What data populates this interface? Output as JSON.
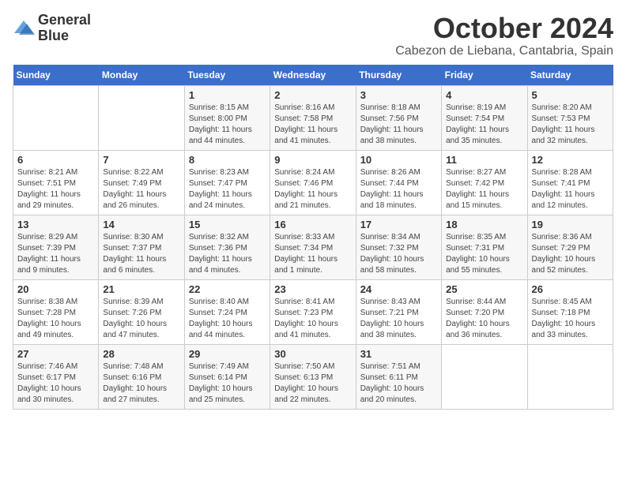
{
  "header": {
    "logo_line1": "General",
    "logo_line2": "Blue",
    "month": "October 2024",
    "location": "Cabezon de Liebana, Cantabria, Spain"
  },
  "days_of_week": [
    "Sunday",
    "Monday",
    "Tuesday",
    "Wednesday",
    "Thursday",
    "Friday",
    "Saturday"
  ],
  "weeks": [
    [
      {
        "day": "",
        "sunrise": "",
        "sunset": "",
        "daylight": ""
      },
      {
        "day": "",
        "sunrise": "",
        "sunset": "",
        "daylight": ""
      },
      {
        "day": "1",
        "sunrise": "Sunrise: 8:15 AM",
        "sunset": "Sunset: 8:00 PM",
        "daylight": "Daylight: 11 hours and 44 minutes."
      },
      {
        "day": "2",
        "sunrise": "Sunrise: 8:16 AM",
        "sunset": "Sunset: 7:58 PM",
        "daylight": "Daylight: 11 hours and 41 minutes."
      },
      {
        "day": "3",
        "sunrise": "Sunrise: 8:18 AM",
        "sunset": "Sunset: 7:56 PM",
        "daylight": "Daylight: 11 hours and 38 minutes."
      },
      {
        "day": "4",
        "sunrise": "Sunrise: 8:19 AM",
        "sunset": "Sunset: 7:54 PM",
        "daylight": "Daylight: 11 hours and 35 minutes."
      },
      {
        "day": "5",
        "sunrise": "Sunrise: 8:20 AM",
        "sunset": "Sunset: 7:53 PM",
        "daylight": "Daylight: 11 hours and 32 minutes."
      }
    ],
    [
      {
        "day": "6",
        "sunrise": "Sunrise: 8:21 AM",
        "sunset": "Sunset: 7:51 PM",
        "daylight": "Daylight: 11 hours and 29 minutes."
      },
      {
        "day": "7",
        "sunrise": "Sunrise: 8:22 AM",
        "sunset": "Sunset: 7:49 PM",
        "daylight": "Daylight: 11 hours and 26 minutes."
      },
      {
        "day": "8",
        "sunrise": "Sunrise: 8:23 AM",
        "sunset": "Sunset: 7:47 PM",
        "daylight": "Daylight: 11 hours and 24 minutes."
      },
      {
        "day": "9",
        "sunrise": "Sunrise: 8:24 AM",
        "sunset": "Sunset: 7:46 PM",
        "daylight": "Daylight: 11 hours and 21 minutes."
      },
      {
        "day": "10",
        "sunrise": "Sunrise: 8:26 AM",
        "sunset": "Sunset: 7:44 PM",
        "daylight": "Daylight: 11 hours and 18 minutes."
      },
      {
        "day": "11",
        "sunrise": "Sunrise: 8:27 AM",
        "sunset": "Sunset: 7:42 PM",
        "daylight": "Daylight: 11 hours and 15 minutes."
      },
      {
        "day": "12",
        "sunrise": "Sunrise: 8:28 AM",
        "sunset": "Sunset: 7:41 PM",
        "daylight": "Daylight: 11 hours and 12 minutes."
      }
    ],
    [
      {
        "day": "13",
        "sunrise": "Sunrise: 8:29 AM",
        "sunset": "Sunset: 7:39 PM",
        "daylight": "Daylight: 11 hours and 9 minutes."
      },
      {
        "day": "14",
        "sunrise": "Sunrise: 8:30 AM",
        "sunset": "Sunset: 7:37 PM",
        "daylight": "Daylight: 11 hours and 6 minutes."
      },
      {
        "day": "15",
        "sunrise": "Sunrise: 8:32 AM",
        "sunset": "Sunset: 7:36 PM",
        "daylight": "Daylight: 11 hours and 4 minutes."
      },
      {
        "day": "16",
        "sunrise": "Sunrise: 8:33 AM",
        "sunset": "Sunset: 7:34 PM",
        "daylight": "Daylight: 11 hours and 1 minute."
      },
      {
        "day": "17",
        "sunrise": "Sunrise: 8:34 AM",
        "sunset": "Sunset: 7:32 PM",
        "daylight": "Daylight: 10 hours and 58 minutes."
      },
      {
        "day": "18",
        "sunrise": "Sunrise: 8:35 AM",
        "sunset": "Sunset: 7:31 PM",
        "daylight": "Daylight: 10 hours and 55 minutes."
      },
      {
        "day": "19",
        "sunrise": "Sunrise: 8:36 AM",
        "sunset": "Sunset: 7:29 PM",
        "daylight": "Daylight: 10 hours and 52 minutes."
      }
    ],
    [
      {
        "day": "20",
        "sunrise": "Sunrise: 8:38 AM",
        "sunset": "Sunset: 7:28 PM",
        "daylight": "Daylight: 10 hours and 49 minutes."
      },
      {
        "day": "21",
        "sunrise": "Sunrise: 8:39 AM",
        "sunset": "Sunset: 7:26 PM",
        "daylight": "Daylight: 10 hours and 47 minutes."
      },
      {
        "day": "22",
        "sunrise": "Sunrise: 8:40 AM",
        "sunset": "Sunset: 7:24 PM",
        "daylight": "Daylight: 10 hours and 44 minutes."
      },
      {
        "day": "23",
        "sunrise": "Sunrise: 8:41 AM",
        "sunset": "Sunset: 7:23 PM",
        "daylight": "Daylight: 10 hours and 41 minutes."
      },
      {
        "day": "24",
        "sunrise": "Sunrise: 8:43 AM",
        "sunset": "Sunset: 7:21 PM",
        "daylight": "Daylight: 10 hours and 38 minutes."
      },
      {
        "day": "25",
        "sunrise": "Sunrise: 8:44 AM",
        "sunset": "Sunset: 7:20 PM",
        "daylight": "Daylight: 10 hours and 36 minutes."
      },
      {
        "day": "26",
        "sunrise": "Sunrise: 8:45 AM",
        "sunset": "Sunset: 7:18 PM",
        "daylight": "Daylight: 10 hours and 33 minutes."
      }
    ],
    [
      {
        "day": "27",
        "sunrise": "Sunrise: 7:46 AM",
        "sunset": "Sunset: 6:17 PM",
        "daylight": "Daylight: 10 hours and 30 minutes."
      },
      {
        "day": "28",
        "sunrise": "Sunrise: 7:48 AM",
        "sunset": "Sunset: 6:16 PM",
        "daylight": "Daylight: 10 hours and 27 minutes."
      },
      {
        "day": "29",
        "sunrise": "Sunrise: 7:49 AM",
        "sunset": "Sunset: 6:14 PM",
        "daylight": "Daylight: 10 hours and 25 minutes."
      },
      {
        "day": "30",
        "sunrise": "Sunrise: 7:50 AM",
        "sunset": "Sunset: 6:13 PM",
        "daylight": "Daylight: 10 hours and 22 minutes."
      },
      {
        "day": "31",
        "sunrise": "Sunrise: 7:51 AM",
        "sunset": "Sunset: 6:11 PM",
        "daylight": "Daylight: 10 hours and 20 minutes."
      },
      {
        "day": "",
        "sunrise": "",
        "sunset": "",
        "daylight": ""
      },
      {
        "day": "",
        "sunrise": "",
        "sunset": "",
        "daylight": ""
      }
    ]
  ]
}
